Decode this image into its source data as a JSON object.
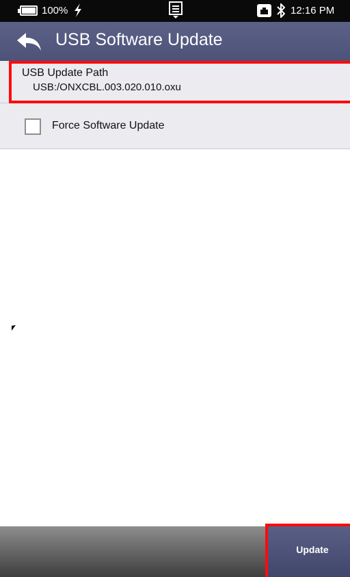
{
  "status_bar": {
    "battery_percent": "100%",
    "battery_level": 1.0,
    "time": "12:16 PM",
    "icons": [
      "battery-icon",
      "charging-icon",
      "notification-icon",
      "ethernet-icon",
      "bluetooth-icon"
    ]
  },
  "app_bar": {
    "title": "USB Software Update",
    "back_icon": "back-arrow-icon",
    "background_color": "#555a80"
  },
  "settings": {
    "usb_update_path": {
      "label": "USB Update Path",
      "value": "USB:/ONXCBL.003.020.010.oxu"
    },
    "force_update": {
      "label": "Force Software Update",
      "checked": false
    }
  },
  "bottom_bar": {
    "update_label": "Update"
  },
  "colors": {
    "highlight": "#ff0b0b",
    "accent": "#555a80",
    "list_background": "#ebebf0"
  }
}
